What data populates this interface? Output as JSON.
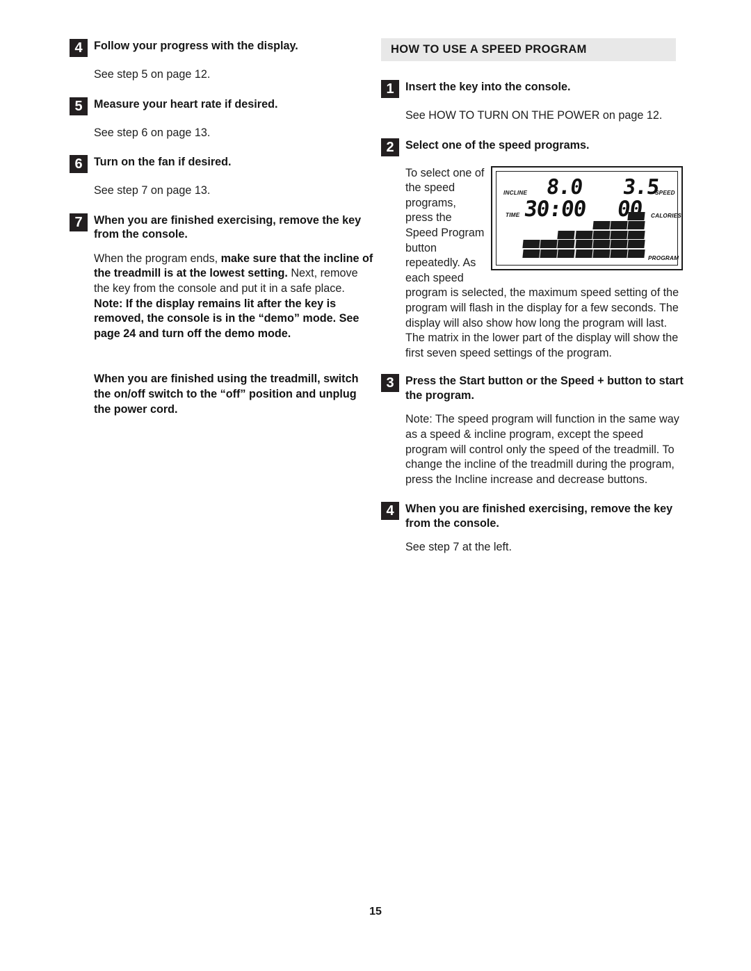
{
  "page": {
    "number": "15"
  },
  "left_column": {
    "steps": [
      {
        "num": "4",
        "title": "Follow your progress with the display.",
        "body": "See step 5 on page 12."
      },
      {
        "num": "5",
        "title": "Measure your heart rate if desired.",
        "body": "See step 6 on page 13."
      },
      {
        "num": "6",
        "title": "Turn on the fan if desired.",
        "body": "See step 7 on page 13."
      },
      {
        "num": "7",
        "title": "When you are finished exercising, remove the key from the console."
      }
    ],
    "paragraph_1": {
      "part_1": "When the program ends, ",
      "part_2_bold": "make sure that the incline of the treadmill is at the lowest setting.",
      "part_3": " Next, remove the key from the console and put it in a safe place. ",
      "part_4_bold": "Note: If the display remains lit after the key is removed, the console is in the “demo” mode. See page 24 and turn off the demo mode."
    },
    "paragraph_2": "When you are finished using the treadmill, switch the on/off switch to the “off” position and unplug the power cord."
  },
  "right_column": {
    "section_title": "HOW TO USE A SPEED PROGRAM",
    "steps": [
      {
        "num": "1",
        "title": "Insert the key into the console.",
        "body": "See HOW TO TURN ON THE POWER on page 12."
      },
      {
        "num": "2",
        "title": "Select one of the speed programs.",
        "wrap_text": "To select one of the speed programs, press the Speed Program button repeatedly. As each speed program is selected, the maximum speed setting of the program will flash in the display for a few seconds. The display will also show how long the program will last. The matrix in the lower part of the display will show the first seven speed settings of the program."
      },
      {
        "num": "3",
        "title": "Press the Start button or the Speed + button to start the program.",
        "body": "Note: The speed program will function in the same way as a speed & incline program, except the speed program will control only the speed of the treadmill. To change the incline of the treadmill during the program, press the Incline increase and decrease buttons."
      },
      {
        "num": "4",
        "title": "When you are finished exercising, remove the key from the console.",
        "body": "See step 7 at the left."
      }
    ]
  },
  "console_display": {
    "incline_value": "8.0",
    "incline_label": "INCLINE",
    "speed_value": "3.5",
    "speed_label": "SPEED",
    "time_value": "30:00",
    "time_label": "TIME",
    "calories_value": "00",
    "calories_label": "CALORIES",
    "program_label": "PROGRAM",
    "matrix_columns": 7,
    "matrix_rows_max": 5,
    "matrix_values": [
      2,
      2,
      3,
      3,
      4,
      4,
      5
    ]
  },
  "colors": {
    "section_bar_bg": "#e8e8e8",
    "step_box_bg": "#231f20",
    "step_box_text": "#ffffff",
    "body_text": "#202020",
    "lcd_segment": "#111111"
  }
}
